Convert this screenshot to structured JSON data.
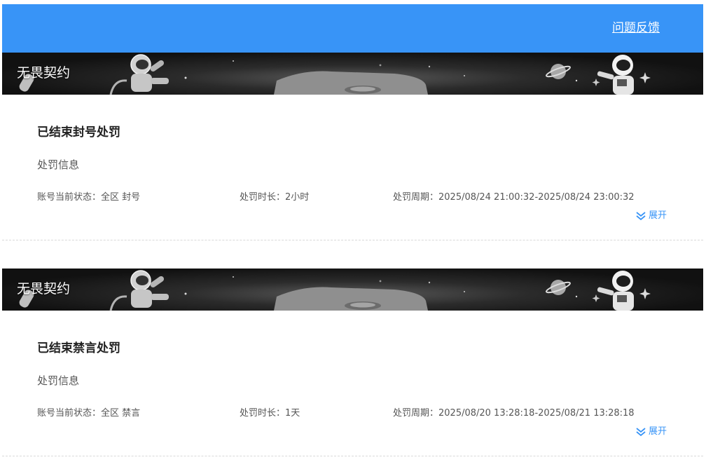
{
  "header": {
    "feedback_label": "问题反馈"
  },
  "records": [
    {
      "game_title": "无畏契约",
      "title": "已结束封号处罚",
      "info_label": "处罚信息",
      "status": "账号当前状态：全区 封号",
      "duration": "处罚时长：2小时",
      "period": "处罚周期：2025/08/24 21:00:32-2025/08/24 23:00:32",
      "expand_label": "展开"
    },
    {
      "game_title": "无畏契约",
      "title": "已结束禁言处罚",
      "info_label": "处罚信息",
      "status": "账号当前状态：全区 禁言",
      "duration": "处罚时长：1天",
      "period": "处罚周期：2025/08/20 13:28:18-2025/08/21 13:28:18",
      "expand_label": "展开"
    }
  ],
  "colors": {
    "header_bg": "#3894f7",
    "link_blue": "#3894f7",
    "text_dark": "#222222",
    "text_muted": "#555555"
  },
  "icons": {
    "expand": "double-chevron-down-icon",
    "banner_art": "astronaut-illustration"
  }
}
